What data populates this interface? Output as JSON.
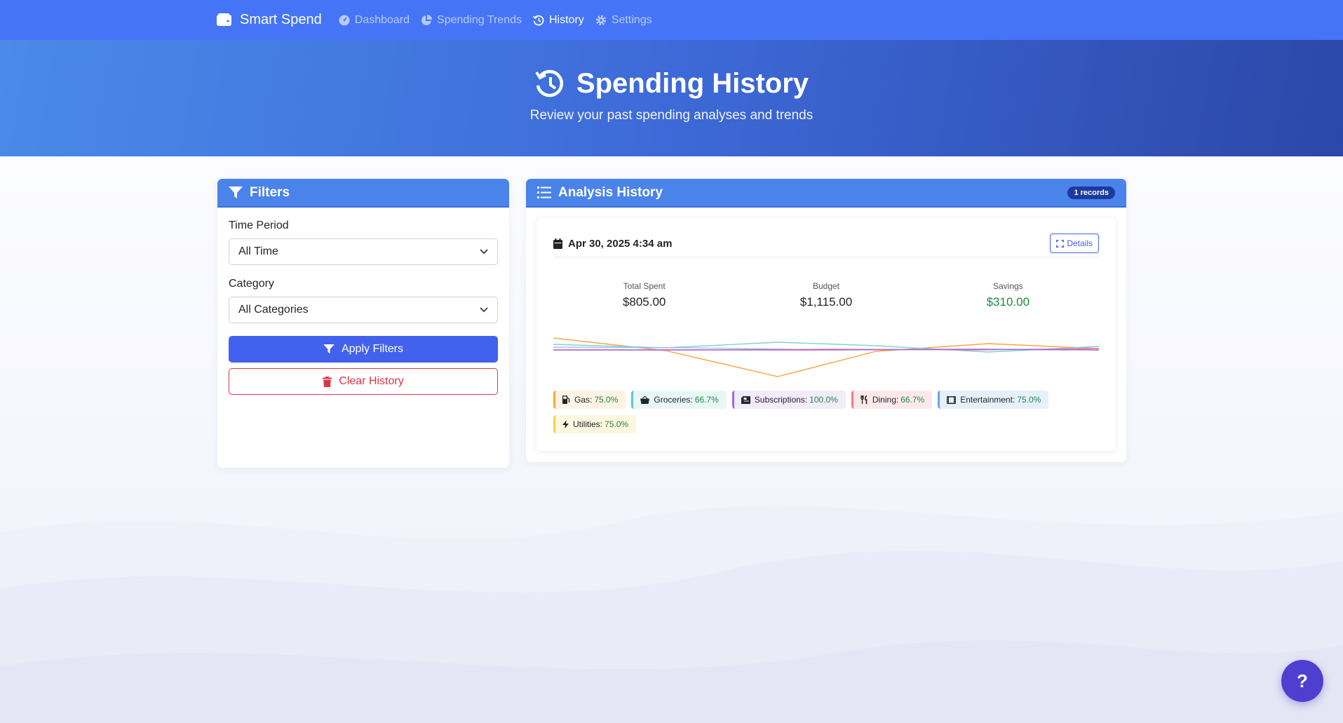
{
  "nav": {
    "brand": "Smart Spend",
    "links": [
      {
        "label": "Dashboard",
        "icon": "dashboard-icon"
      },
      {
        "label": "Spending Trends",
        "icon": "pie-chart-icon"
      },
      {
        "label": "History",
        "icon": "history-icon",
        "active": true
      },
      {
        "label": "Settings",
        "icon": "gear-icon"
      }
    ]
  },
  "hero": {
    "title": "Spending History",
    "subtitle": "Review your past spending analyses and trends"
  },
  "filters": {
    "title": "Filters",
    "time_period_label": "Time Period",
    "time_period_value": "All Time",
    "category_label": "Category",
    "category_value": "All Categories",
    "apply_label": "Apply Filters",
    "clear_label": "Clear History"
  },
  "history": {
    "title": "Analysis History",
    "badge": "1 records",
    "record": {
      "date": "Apr 30, 2025 4:34 am",
      "details_label": "Details",
      "total_spent_label": "Total Spent",
      "total_spent": "$805.00",
      "budget_label": "Budget",
      "budget": "$1,115.00",
      "savings_label": "Savings",
      "savings": "$310.00",
      "categories": [
        {
          "name": "Gas:",
          "pct": "75.0%",
          "icon": "gas-pump-icon",
          "color": "#f5a742",
          "bg": "#fdf3e4"
        },
        {
          "name": "Groceries:",
          "pct": "66.7%",
          "icon": "basket-icon",
          "color": "#5dc9c1",
          "bg": "#e7f7f5"
        },
        {
          "name": "Subscriptions:",
          "pct": "100.0%",
          "icon": "newspaper-icon",
          "color": "#a06be0",
          "bg": "#f1ebfa"
        },
        {
          "name": "Dining:",
          "pct": "66.7%",
          "icon": "utensils-icon",
          "color": "#f07a8c",
          "bg": "#fde9ec"
        },
        {
          "name": "Entertainment:",
          "pct": "75.0%",
          "icon": "film-icon",
          "color": "#6aa3e8",
          "bg": "#e6f0fb"
        },
        {
          "name": "Utilities:",
          "pct": "75.0%",
          "icon": "bolt-icon",
          "color": "#f5cf4a",
          "bg": "#fdf7e0"
        }
      ]
    }
  }
}
